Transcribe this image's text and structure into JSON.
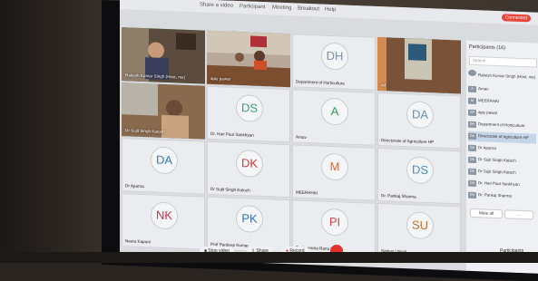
{
  "menubar": {
    "items": [
      "Share a video",
      "Participant",
      "Meeting",
      "Breakout",
      "Help"
    ],
    "status": "Connected"
  },
  "tiles": [
    {
      "name": "Rakesh Kumar Singh (Host, me)",
      "initials": "",
      "video": true
    },
    {
      "name": "ajay pawar",
      "initials": "",
      "video": true
    },
    {
      "name": "Department of Horticulture",
      "initials": "DH",
      "video": false
    },
    {
      "name": "ad",
      "initials": "",
      "video": true
    },
    {
      "name": "Dr Sujit Singh Katoch",
      "initials": "",
      "video": true
    },
    {
      "name": "Dr. Hari Paul Sankhyan",
      "initials": "DS",
      "video": false
    },
    {
      "name": "Amav",
      "initials": "A",
      "video": false
    },
    {
      "name": "Directorate of Agriculture HP",
      "initials": "DA",
      "video": false
    },
    {
      "name": "Dr Aparna",
      "initials": "DA",
      "video": false
    },
    {
      "name": "Dr Sujit Singh Katoch",
      "initials": "DK",
      "video": false
    },
    {
      "name": "MEERAHAI",
      "initials": "M",
      "video": false
    },
    {
      "name": "Dr. Pankaj Sharma",
      "initials": "DS",
      "video": false
    },
    {
      "name": "Neetu Kapoor",
      "initials": "NK",
      "video": false
    },
    {
      "name": "Prof Pardeep Kumar",
      "initials": "PK",
      "video": false
    },
    {
      "name": "Pushpendra Rana IFS",
      "initials": "PI",
      "video": false
    },
    {
      "name": "Sanjay Uniyal",
      "initials": "SU",
      "video": false
    }
  ],
  "panel": {
    "title": "Participants (16)",
    "search_placeholder": "Search",
    "items": [
      {
        "ini": "",
        "name": "Rakesh Kumar Singh (Host, me)"
      },
      {
        "ini": "A",
        "name": "Arnav"
      },
      {
        "ini": "M",
        "name": "MEERAHAI"
      },
      {
        "ini": "AP",
        "name": "ajay pawar"
      },
      {
        "ini": "DH",
        "name": "Department of Horticulture"
      },
      {
        "ini": "DA",
        "name": "Directorate of Agriculture HP"
      },
      {
        "ini": "DA",
        "name": "Dr Aparna"
      },
      {
        "ini": "DK",
        "name": "Dr Sujit Singh Katoch"
      },
      {
        "ini": "DK",
        "name": "Dr Sujit Singh Katoch"
      },
      {
        "ini": "DS",
        "name": "Dr. Hari Paul Sankhyan"
      },
      {
        "ini": "DS",
        "name": "Dr. Pankaj Sharma"
      }
    ],
    "mute_all": "Mute all"
  },
  "toolbar": {
    "stop_video": "Stop video",
    "share": "Share",
    "record": "Record",
    "participants": "Participants"
  }
}
